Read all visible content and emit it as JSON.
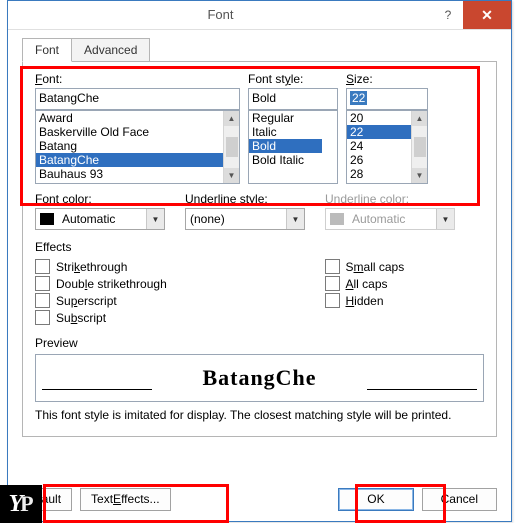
{
  "titlebar": {
    "title": "Font",
    "help_glyph": "?",
    "close_glyph": "✕"
  },
  "tabs": {
    "font": "Font",
    "advanced": "Advanced"
  },
  "labels": {
    "font": "Font:",
    "font_u": "F",
    "style": "Font style:",
    "style_u": "y",
    "size": "Size:",
    "size_u": "S",
    "font_color": "Font color:",
    "underline_style": "Underline style:",
    "underline_color": "Underline color:",
    "effects": "Effects",
    "preview": "Preview"
  },
  "inputs": {
    "font_value": "BatangChe",
    "style_value": "Bold",
    "size_value": "22"
  },
  "lists": {
    "fonts": [
      "Award",
      "Baskerville Old Face",
      "Batang",
      "BatangChe",
      "Bauhaus 93"
    ],
    "styles": [
      "Regular",
      "Italic",
      "Bold",
      "Bold Italic"
    ],
    "sizes": [
      "20",
      "22",
      "24",
      "26",
      "28"
    ]
  },
  "list_selected": {
    "font_index": 3,
    "style_index": 2,
    "size_index": 1
  },
  "dropdowns": {
    "font_color": "Automatic",
    "underline_style": "(none)",
    "underline_color": "Automatic"
  },
  "effects_left": [
    {
      "label": "Strikethrough",
      "u": "k"
    },
    {
      "label": "Double strikethrough",
      "u": "l"
    },
    {
      "label": "Superscript",
      "u": "p"
    },
    {
      "label": "Subscript",
      "u": "b"
    }
  ],
  "effects_right": [
    {
      "label": "Small caps",
      "u": "m"
    },
    {
      "label": "All caps",
      "u": "A"
    },
    {
      "label": "Hidden",
      "u": "H"
    }
  ],
  "preview_text": "BatangChe",
  "note_text": "This font style is imitated for display. The closest matching style will be printed.",
  "buttons": {
    "set_default": "Set As Default",
    "text_effects": "Text Effects...",
    "ok": "OK",
    "cancel": "Cancel"
  },
  "badge": {
    "Y": "Y",
    "P": "P"
  }
}
